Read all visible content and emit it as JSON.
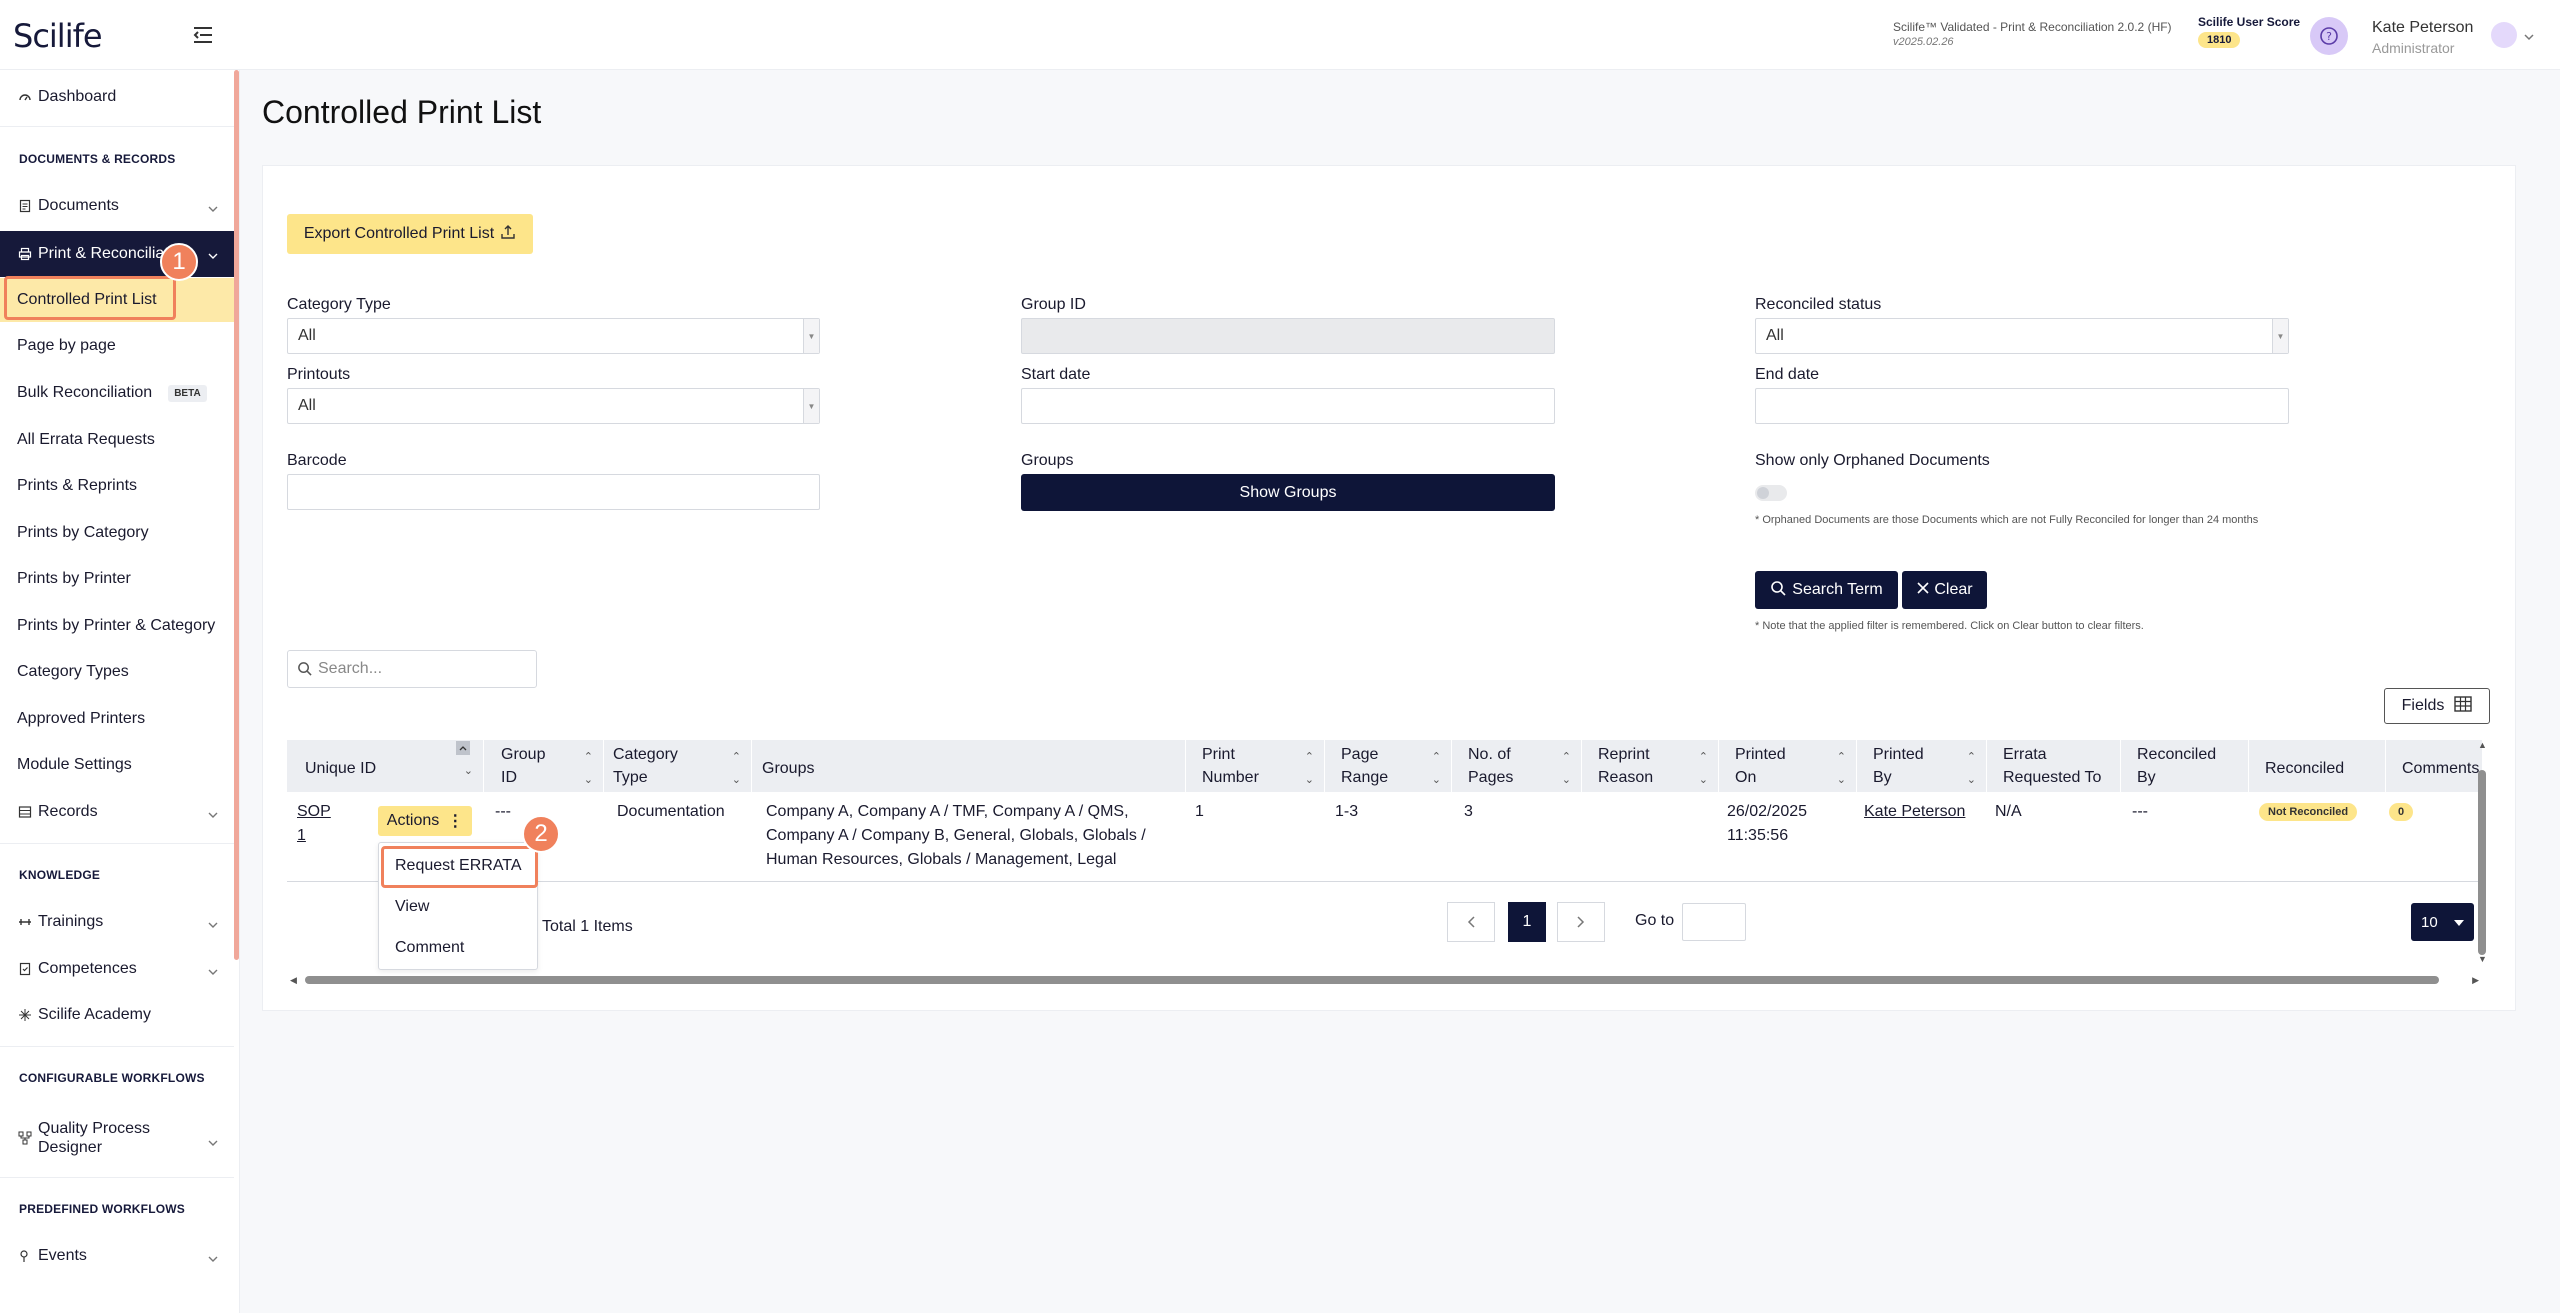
{
  "header": {
    "logo": "Scilife",
    "version_line": "Scilife™ Validated - Print & Reconciliation 2.0.2 (HF)",
    "version_date": "v2025.02.26",
    "score_label": "Scilife User Score",
    "score_value": "1810",
    "user_name": "Kate Peterson",
    "user_role": "Administrator"
  },
  "sidebar": {
    "dashboard": "Dashboard",
    "section_docs": "DOCUMENTS & RECORDS",
    "documents": "Documents",
    "print_reconciliation": "Print & Reconciliation",
    "controlled_print_list": "Controlled Print List",
    "page_by_page": "Page by page",
    "bulk_reconciliation": "Bulk Reconciliation",
    "beta": "BETA",
    "all_errata": "All Errata Requests",
    "prints_reprints": "Prints & Reprints",
    "prints_by_category": "Prints by Category",
    "prints_by_printer": "Prints by Printer",
    "prints_by_printer_category": "Prints by Printer & Category",
    "category_types": "Category Types",
    "approved_printers": "Approved Printers",
    "module_settings": "Module Settings",
    "records": "Records",
    "section_knowledge": "KNOWLEDGE",
    "trainings": "Trainings",
    "competences": "Competences",
    "academy": "Scilife Academy",
    "section_config": "CONFIGURABLE WORKFLOWS",
    "quality_designer_1": "Quality Process",
    "quality_designer_2": "Designer",
    "section_predefined": "PREDEFINED WORKFLOWS",
    "events": "Events"
  },
  "callouts": {
    "one": "1",
    "two": "2"
  },
  "page": {
    "title": "Controlled Print List",
    "export_label": "Export Controlled Print List"
  },
  "filters": {
    "category_type_label": "Category Type",
    "category_type_value": "All",
    "group_id_label": "Group ID",
    "reconciled_status_label": "Reconciled status",
    "reconciled_status_value": "All",
    "printouts_label": "Printouts",
    "printouts_value": "All",
    "start_date_label": "Start date",
    "end_date_label": "End date",
    "barcode_label": "Barcode",
    "groups_label": "Groups",
    "show_groups": "Show Groups",
    "orphaned_label": "Show only Orphaned Documents",
    "orphaned_note": "* Orphaned Documents are those Documents which are not Fully Reconciled for longer than 24 months",
    "search_term": "Search Term",
    "clear": "Clear",
    "filter_note": "* Note that the applied filter is remembered. Click on Clear button to clear filters."
  },
  "table": {
    "search_placeholder": "Search...",
    "fields_label": "Fields",
    "headers": {
      "unique_id": "Unique ID",
      "group_id_1": "Group",
      "group_id_2": "ID",
      "category_1": "Category",
      "category_2": "Type",
      "groups": "Groups",
      "print_number_1": "Print",
      "print_number_2": "Number",
      "page_range_1": "Page",
      "page_range_2": "Range",
      "no_pages_1": "No. of",
      "no_pages_2": "Pages",
      "reprint_1": "Reprint",
      "reprint_2": "Reason",
      "printed_on_1": "Printed",
      "printed_on_2": "On",
      "printed_by_1": "Printed",
      "printed_by_2": "By",
      "errata_1": "Errata",
      "errata_2": "Requested To",
      "reconciled_by_1": "Reconciled",
      "reconciled_by_2": "By",
      "reconciled": "Reconciled",
      "comments": "Comments"
    },
    "row": {
      "unique_id_1": "SOP",
      "unique_id_2": "1",
      "actions": "Actions",
      "group_id": "---",
      "category": "Documentation",
      "groups_1": "Company A, Company A / TMF, Company A / QMS,",
      "groups_2": "Company A / Company B, General, Globals, Globals /",
      "groups_3": "Human Resources, Globals / Management, Legal",
      "print_number": "1",
      "page_range": "1-3",
      "no_pages": "3",
      "printed_on_1": "26/02/2025",
      "printed_on_2": "11:35:56",
      "printed_by": "Kate Peterson",
      "errata": "N/A",
      "reconciled_by": "---",
      "reconciled": "Not Reconciled",
      "comments": "0"
    },
    "actions_menu": [
      "Request ERRATA",
      "View",
      "Comment"
    ],
    "total": "Total 1 Items",
    "page_current": "1",
    "go_to": "Go to",
    "page_size": "10"
  }
}
